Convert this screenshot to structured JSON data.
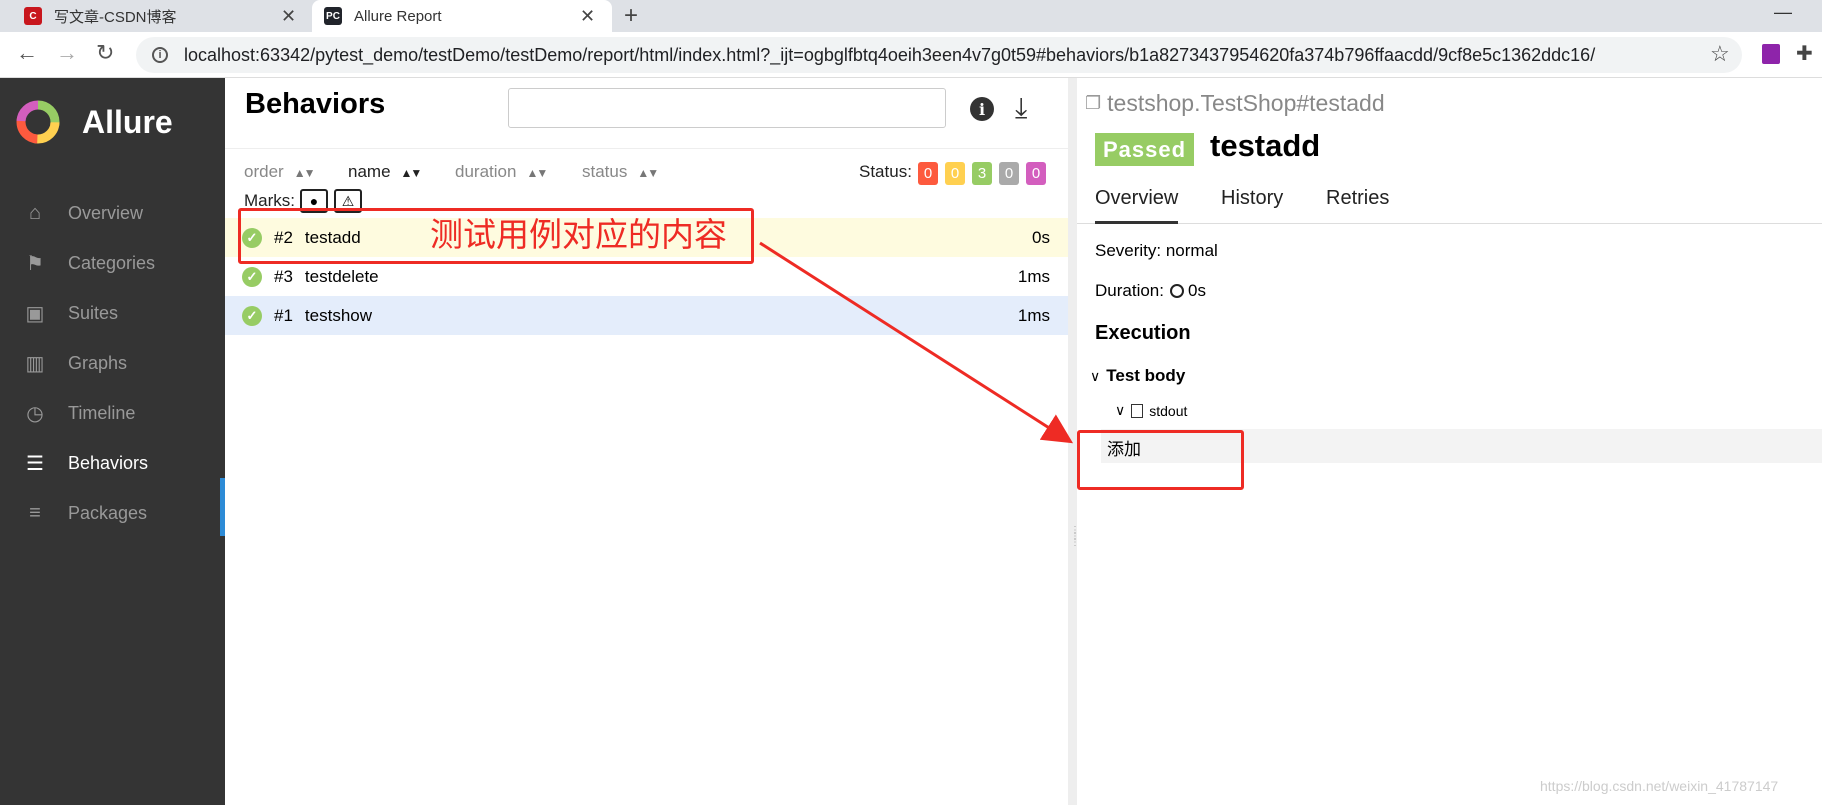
{
  "browser": {
    "tabs": [
      {
        "title": "写文章-CSDN博客",
        "favicon": "C"
      },
      {
        "title": "Allure Report",
        "favicon": "PC"
      }
    ],
    "new_tab": "+",
    "url": "localhost:63342/pytest_demo/testDemo/testDemo/report/html/index.html?_ijt=ogbglfbtq4oeih3een4v7g0t59#behaviors/b1a8273437954620fa374b796ffaacdd/9cf8e5c1362ddc16/",
    "close_glyph": "✕"
  },
  "sidebar": {
    "brand": "Allure",
    "items": [
      {
        "label": "Overview",
        "icon": "home-icon"
      },
      {
        "label": "Categories",
        "icon": "flag-icon"
      },
      {
        "label": "Suites",
        "icon": "briefcase-icon"
      },
      {
        "label": "Graphs",
        "icon": "bar-chart-icon"
      },
      {
        "label": "Timeline",
        "icon": "clock-icon"
      },
      {
        "label": "Behaviors",
        "icon": "list-icon"
      },
      {
        "label": "Packages",
        "icon": "align-left-icon"
      }
    ]
  },
  "behaviors": {
    "title": "Behaviors",
    "sort": {
      "order": "order",
      "name": "name",
      "duration": "duration",
      "status": "status"
    },
    "status_label": "Status:",
    "status_counts": [
      {
        "value": "0",
        "color": "#fd5a3e"
      },
      {
        "value": "0",
        "color": "#ffd050"
      },
      {
        "value": "3",
        "color": "#97cc64"
      },
      {
        "value": "0",
        "color": "#aaaaaa"
      },
      {
        "value": "0",
        "color": "#d35ebe"
      }
    ],
    "marks_label": "Marks:",
    "rows": [
      {
        "num": "#2",
        "name": "testadd",
        "duration": "0s"
      },
      {
        "num": "#3",
        "name": "testdelete",
        "duration": "1ms"
      },
      {
        "num": "#1",
        "name": "testshow",
        "duration": "1ms"
      }
    ]
  },
  "detail": {
    "crumb": "testshop.TestShop#testadd",
    "status": "Passed",
    "name": "testadd",
    "tabs": [
      "Overview",
      "History",
      "Retries"
    ],
    "severity": "Severity: normal",
    "duration_label": "Duration:",
    "duration_value": "0s",
    "execution": "Execution",
    "test_body": "Test body",
    "attachment": "stdout",
    "attachment_content": "添加"
  },
  "annotation": {
    "text": "测试用例对应的内容",
    "color": "#ee2b24"
  },
  "watermark": "https://blog.csdn.net/weixin_41787147"
}
